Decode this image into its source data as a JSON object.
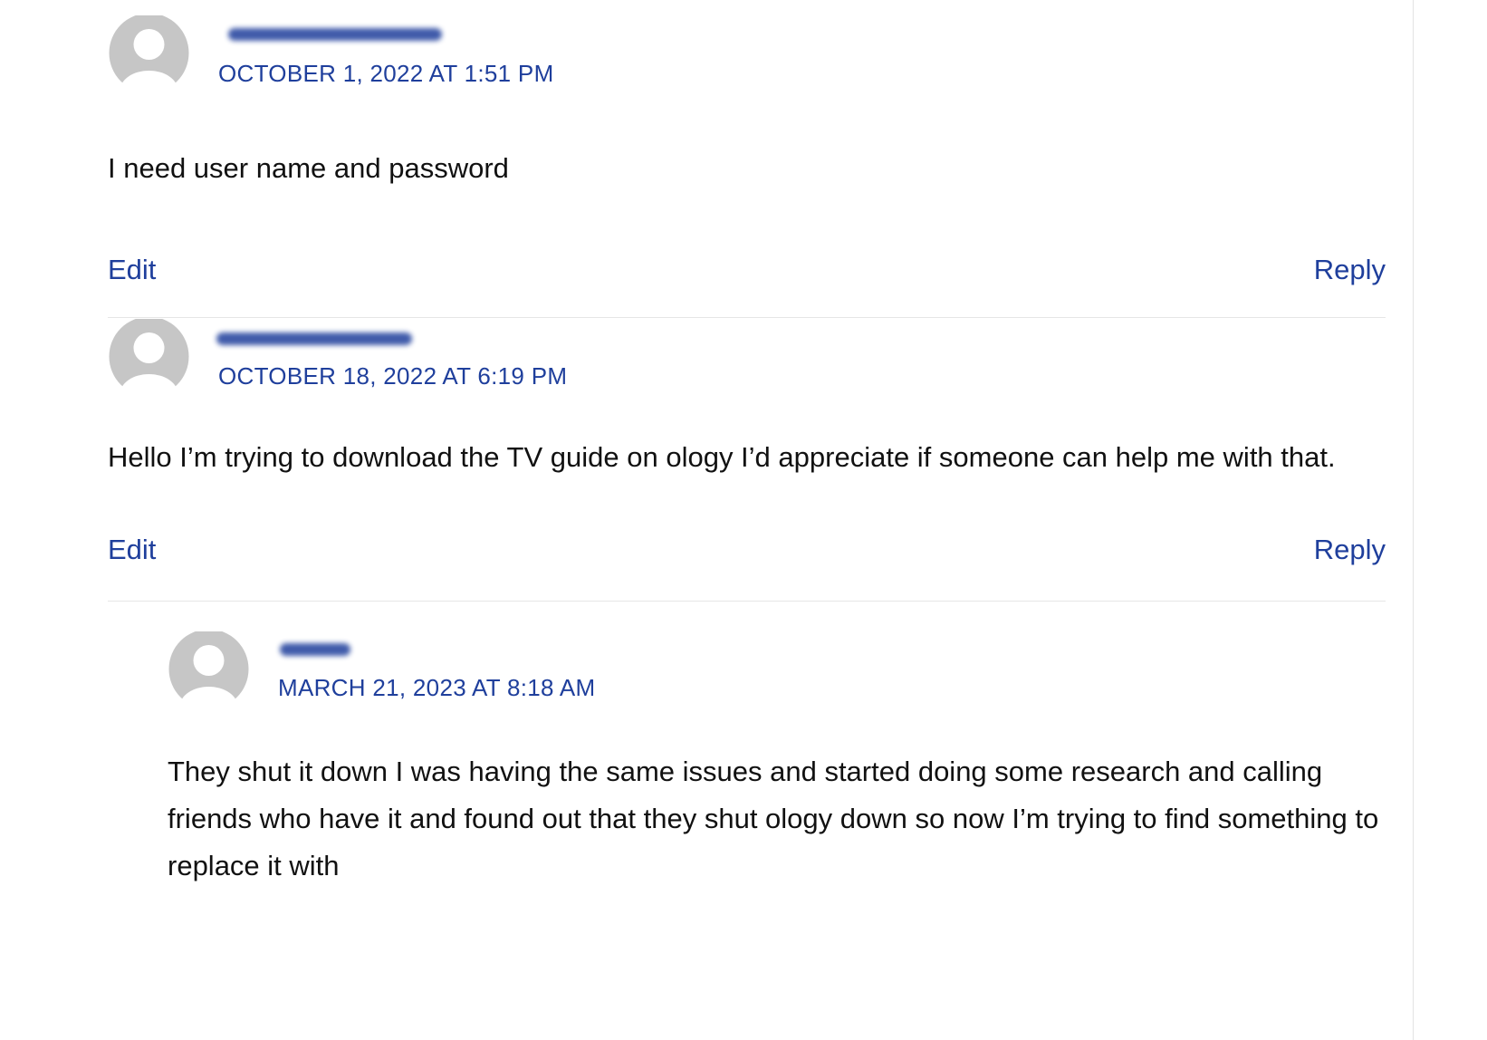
{
  "theme": {
    "link_color": "#1f3f9c",
    "text_color": "#111111",
    "avatar_bg": "#c6c6c6",
    "avatar_fg": "#ffffff",
    "divider_color": "#e6e6e6"
  },
  "comments": [
    {
      "author_name": "",
      "date": "OCTOBER 1, 2022 AT 1:51 PM",
      "text": "I need user name and password",
      "edit_label": "Edit",
      "reply_label": "Reply",
      "avatar_icon": "default-user-icon"
    },
    {
      "author_name": "",
      "date": "OCTOBER 18, 2022 AT 6:19 PM",
      "text": "Hello I’m trying to download the TV guide on ology I’d appreciate if someone can help me with that.",
      "edit_label": "Edit",
      "reply_label": "Reply",
      "avatar_icon": "default-user-icon"
    },
    {
      "author_name": "",
      "date": "MARCH 21, 2023 AT 8:18 AM",
      "text": "They shut it down I was having the same issues and started doing some research and calling friends who have it and found out that they shut ology down so now I’m trying to find something to replace it with",
      "avatar_icon": "default-user-icon"
    }
  ]
}
